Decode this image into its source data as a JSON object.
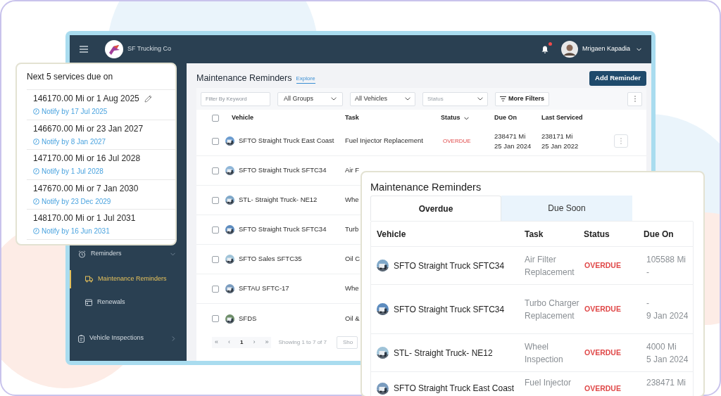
{
  "app": {
    "brand": "SF Trucking Co",
    "user": "Mrigaen Kapadia",
    "notification_unread": true
  },
  "sidebar": {
    "items": [
      {
        "label": "Reminders",
        "expanded": true,
        "selected": false,
        "children": [
          {
            "label": "Maintenance Reminders",
            "selected": true
          },
          {
            "label": "Renewals",
            "selected": false
          }
        ]
      },
      {
        "label": "Vehicle Inspections",
        "expanded": false,
        "selected": false
      }
    ]
  },
  "page": {
    "title": "Maintenance Reminders",
    "explore_link": "Explore",
    "add_button": "Add Reminder",
    "filters": {
      "keyword_placeholder": "Filter By Keyword",
      "group": "All Groups",
      "vehicles": "All Vehicles",
      "status_placeholder": "Status",
      "more_filters": "More Filters"
    }
  },
  "table": {
    "columns": [
      "Vehicle",
      "Task",
      "Status",
      "Due On",
      "Last Serviced"
    ],
    "all_checked": false,
    "rows": [
      {
        "vehicle": "SFTO Straight Truck East Coast",
        "task": "Fuel Injector Replacement",
        "status": "OVERDUE",
        "due_on": [
          "238471 Mi",
          "25 Jan 2024"
        ],
        "last_serviced": [
          "238171 Mi",
          "25 Jan 2022"
        ],
        "checked": false
      },
      {
        "vehicle": "SFTO Straight Truck SFTC34",
        "task": "Air F",
        "checked": false
      },
      {
        "vehicle": "STL- Straight Truck- NE12",
        "task": "Whe",
        "checked": false
      },
      {
        "vehicle": "SFTO Straight Truck SFTC34",
        "task": "Turb",
        "checked": false
      },
      {
        "vehicle": "SFTO Sales SFTC35",
        "task": "Oil C",
        "checked": false
      },
      {
        "vehicle": "SFTAU SFTC-17",
        "task": "Whe",
        "checked": false
      },
      {
        "vehicle": "SFDS",
        "task": "Oil &",
        "checked": false
      }
    ]
  },
  "pagination": {
    "first": "«",
    "prev": "‹",
    "pages": [
      {
        "label": "1",
        "selected": true
      }
    ],
    "next": "›",
    "last": "»",
    "summary": "Showing 1 to 7 of 7",
    "page_size": "Sho"
  },
  "services_card": {
    "title": "Next 5 services due on",
    "items": [
      {
        "due": "146170.00 Mi or 1 Aug 2025",
        "notify": "Notify by 17 Jul 2025",
        "editable": true
      },
      {
        "due": "146670.00 Mi or 23 Jan 2027",
        "notify": "Notify by 8 Jan 2027",
        "editable": false
      },
      {
        "due": "147170.00 Mi or 16 Jul 2028",
        "notify": "Notify by 1 Jul 2028",
        "editable": false
      },
      {
        "due": "147670.00 Mi or 7 Jan 2030",
        "notify": "Notify by 23 Dec 2029",
        "editable": false
      },
      {
        "due": "148170.00 Mi or 1 Jul 2031",
        "notify": "Notify by 16 Jun 2031",
        "editable": false
      }
    ]
  },
  "overdue_card": {
    "title": "Maintenance Reminders",
    "tabs": [
      {
        "label": "Overdue",
        "selected": true
      },
      {
        "label": "Due Soon",
        "selected": false
      }
    ],
    "columns": [
      "Vehicle",
      "Task",
      "Status",
      "Due On"
    ],
    "rows": [
      {
        "vehicle": "SFTO Straight Truck SFTC34",
        "task": "Air Filter Replacement",
        "status": "OVERDUE",
        "due_on": [
          "105588 Mi",
          "-"
        ]
      },
      {
        "vehicle": "SFTO Straight Truck SFTC34",
        "task": "Turbo Charger Replacement",
        "status": "OVERDUE",
        "due_on": [
          "-",
          "9 Jan 2024"
        ]
      },
      {
        "vehicle": "STL- Straight Truck- NE12",
        "task": "Wheel Inspection",
        "status": "OVERDUE",
        "due_on": [
          "4000 Mi",
          "5 Jan 2024"
        ]
      },
      {
        "vehicle": "SFTO Straight Truck East Coast",
        "task": "Fuel Injector",
        "status": "OVERDUE",
        "due_on": [
          "238471 Mi"
        ]
      }
    ]
  }
}
